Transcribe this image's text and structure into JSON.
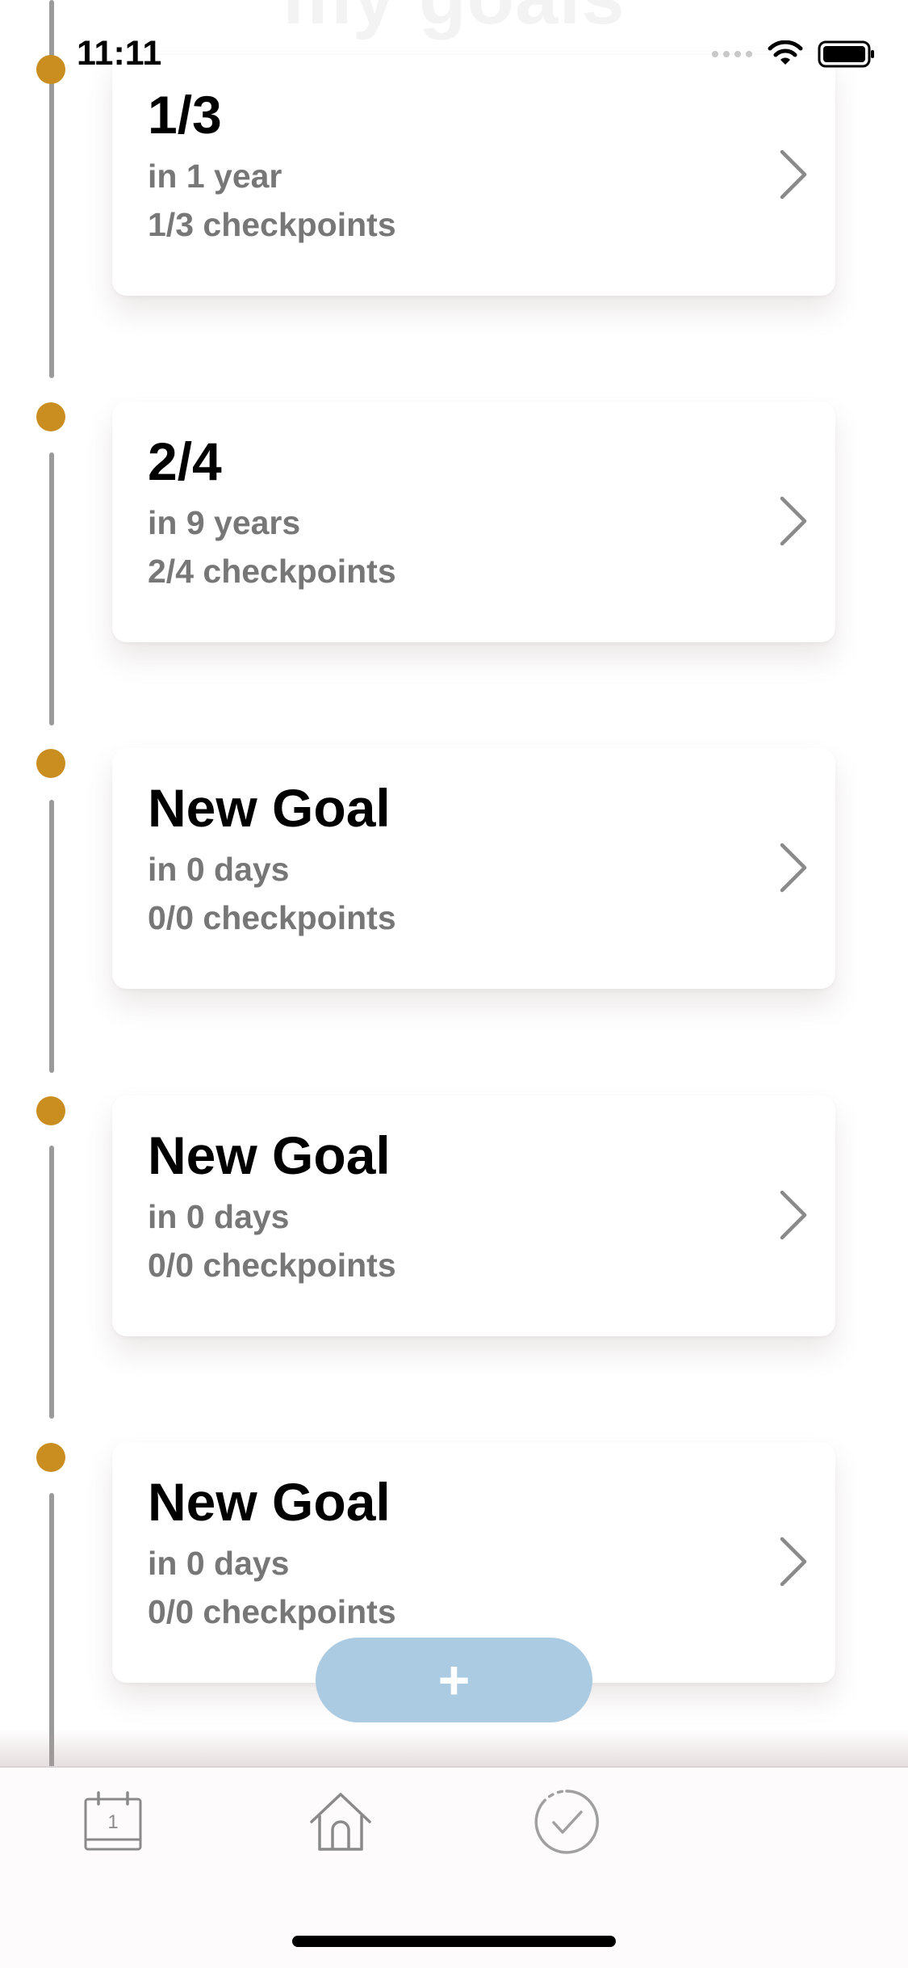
{
  "header": {
    "title": "my goals"
  },
  "status_bar": {
    "time": "11:11"
  },
  "goals": [
    {
      "title": "1/3",
      "due": "in 1 year",
      "progress": "1/3 checkpoints"
    },
    {
      "title": "2/4",
      "due": "in 9 years",
      "progress": "2/4 checkpoints"
    },
    {
      "title": "New Goal",
      "due": "in 0 days",
      "progress": "0/0 checkpoints"
    },
    {
      "title": "New Goal",
      "due": "in 0 days",
      "progress": "0/0 checkpoints"
    },
    {
      "title": "New Goal",
      "due": "in 0 days",
      "progress": "0/0 checkpoints"
    }
  ],
  "add_button": {
    "label": "+"
  },
  "tab_bar": {
    "items": [
      {
        "icon": "calendar-icon",
        "badge": "1"
      },
      {
        "icon": "home-icon"
      },
      {
        "icon": "checkmark-circle-icon"
      }
    ]
  },
  "colors": {
    "timeline_dot": "#c98e1f",
    "timeline_line": "#9a9a9a",
    "add_button": "#abcbe2",
    "secondary_text": "#777777"
  }
}
